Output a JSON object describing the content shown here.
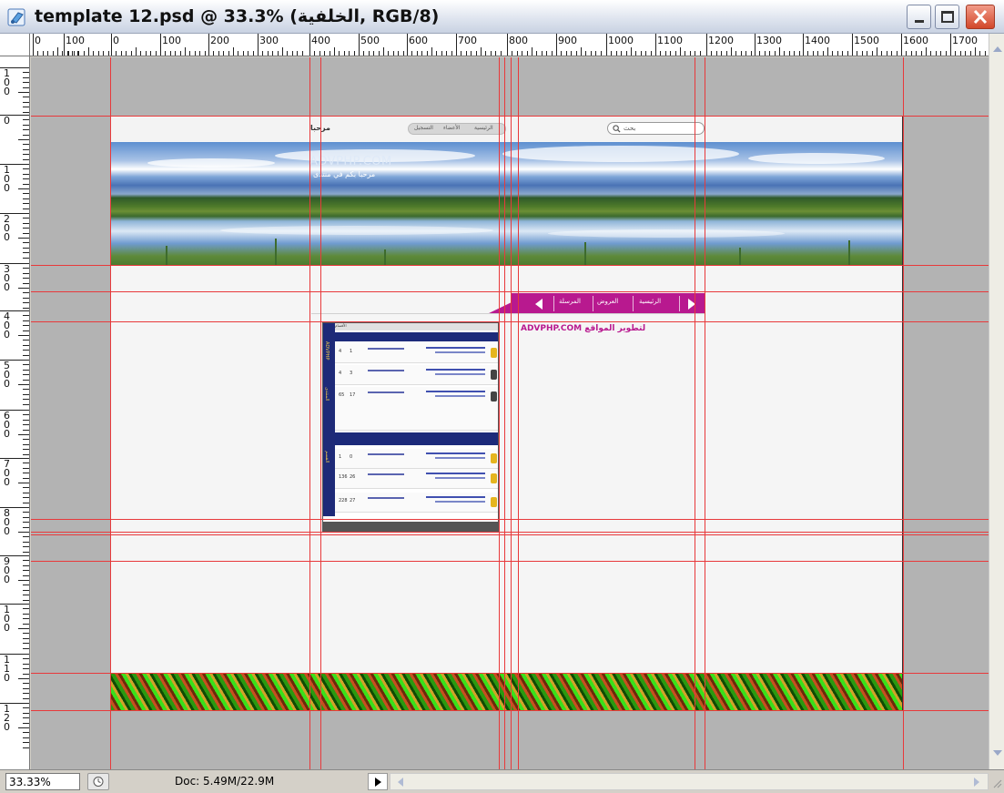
{
  "window": {
    "title": "template 12.psd @ 33.3% (الخلفية, RGB/8)",
    "icon": "photoshop-document-icon"
  },
  "ruler": {
    "h_labels": [
      "0",
      "100",
      "0",
      "100",
      "200",
      "300",
      "400",
      "500",
      "600",
      "700",
      "800",
      "900",
      "1000",
      "1100",
      "1200",
      "1300",
      "1400",
      "1500",
      "1600",
      "1700"
    ],
    "v_labels": [
      "1\n0\n0",
      "0",
      "1\n0\n0",
      "2\n0\n0",
      "3\n0\n0",
      "4\n0\n0",
      "5\n0\n0",
      "6\n0\n0",
      "7\n0\n0",
      "8\n0\n0",
      "9\n0\n0",
      "1\n0\n0",
      "1\n1\n0",
      "1\n2\n0"
    ]
  },
  "document": {
    "brand_top": "مرحبا",
    "pill_nav": [
      "الرئيسية",
      "الأعضاء",
      "التسجيل"
    ],
    "search_text": "بحث",
    "banner_logo": "ADVPHP.COM",
    "banner_sub": "مرحبا بكم في منتدى",
    "nav_items": [
      "الرئيسية",
      "العروض",
      "المرسلة"
    ],
    "tagline": "ADVPHP.COM لتطوير المواقع",
    "preview_side": [
      "ADVPHP",
      "المنتدى",
      "القسم"
    ],
    "preview_head": "الأقسام",
    "preview_rows": [
      {
        "a": "4",
        "b": "1"
      },
      {
        "a": "4",
        "b": "3"
      },
      {
        "a": "65",
        "b": "17"
      },
      {
        "a": "1",
        "b": "0"
      },
      {
        "a": "136",
        "b": "26"
      },
      {
        "a": "228",
        "b": "27"
      }
    ]
  },
  "status": {
    "zoom": "33.33%",
    "doc_info": "Doc: 5.49M/22.9M"
  },
  "colors": {
    "accent": "#b8198f",
    "guide": "#e8393b",
    "canvas": "#b3b3b3"
  }
}
